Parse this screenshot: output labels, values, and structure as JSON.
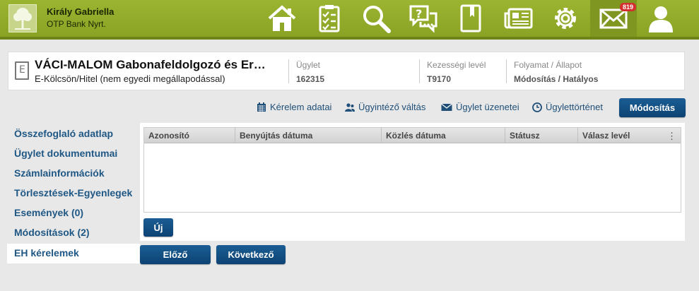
{
  "user": {
    "name": "Király Gabriella",
    "bank": "OTP Bank Nyrt."
  },
  "nav": {
    "icons": [
      "home-icon",
      "checklist-icon",
      "search-icon",
      "help-chat-icon",
      "book-icon",
      "news-icon",
      "gear-icon",
      "mail-icon",
      "user-icon"
    ],
    "mail_badge": "819"
  },
  "header": {
    "title": "VÁCI-MALOM Gabonafeldolgozó és Er…",
    "subtitle": "E-Kölcsön/Hitel (nem egyedi megállapodással)",
    "fields": [
      {
        "label": "Ügylet",
        "value": "162315"
      },
      {
        "label": "Kezességi levél",
        "value": "T9170"
      },
      {
        "label": "Folyamat / Állapot",
        "value": "Módosítás / Hatályos"
      }
    ]
  },
  "actions": {
    "request_data": "Kérelem adatai",
    "change_agent": "Ügyintéző váltás",
    "messages": "Ügylet üzenetei",
    "history": "Ügylettörténet",
    "modify": "Módosítás"
  },
  "sidebar": {
    "items": [
      {
        "label": "Összefoglaló adatlap"
      },
      {
        "label": "Ügylet dokumentumai"
      },
      {
        "label": "Számlainformációk"
      },
      {
        "label": "Törlesztések-Egyenlegek"
      },
      {
        "label": "Események (0)"
      },
      {
        "label": "Módosítások (2)"
      },
      {
        "label": "EH kérelemek"
      }
    ],
    "active_index": 6
  },
  "table": {
    "columns": [
      "Azonosító",
      "Benyújtás dátuma",
      "Közlés dátuma",
      "Státusz",
      "Válasz levél"
    ],
    "rows": [],
    "menu_icon": "⋮"
  },
  "buttons": {
    "new": "Új",
    "prev": "Előző",
    "next": "Következő"
  },
  "colors": {
    "topbar": "#8aa324",
    "primary": "#0d4373",
    "link": "#1f5785"
  }
}
